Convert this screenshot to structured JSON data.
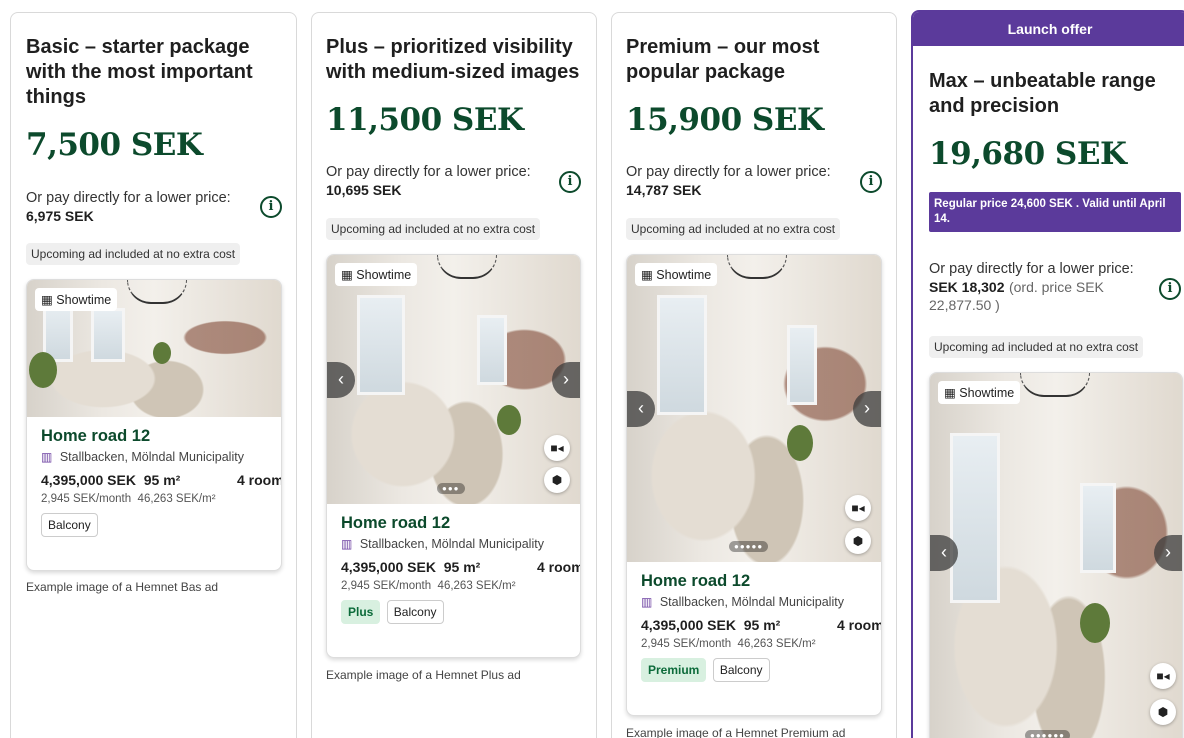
{
  "packages": [
    {
      "title": "Basic – starter package with the most important things",
      "price": "7,500 SEK",
      "direct_text": "Or pay directly for a lower price:",
      "direct_amount": "6,975 SEK",
      "direct_ord": "",
      "chip": "Upcoming ad included at no extra cost",
      "showtime": "Showtime",
      "address": "Home road 12",
      "location": "Stallbacken, Mölndal Municipality",
      "price_sek": "4,395,000 SEK",
      "area": "95 m²",
      "rooms": "4 room",
      "monthly": "2,945 SEK/month",
      "per_sqm": "46,263 SEK/m²",
      "level_tag": "",
      "feature_tag": "Balcony",
      "caption": "Example image of a Hemnet Bas ad"
    },
    {
      "title": "Plus – prioritized visibility with medium-sized images",
      "price": "11,500 SEK",
      "direct_text": "Or pay directly for a lower price:",
      "direct_amount": "10,695 SEK",
      "direct_ord": "",
      "chip": "Upcoming ad included at no extra cost",
      "showtime": "Showtime",
      "address": "Home road 12",
      "location": "Stallbacken, Mölndal Municipality",
      "price_sek": "4,395,000 SEK",
      "area": "95 m²",
      "rooms": "4 room",
      "monthly": "2,945 SEK/month",
      "per_sqm": "46,263 SEK/m²",
      "level_tag": "Plus",
      "feature_tag": "Balcony",
      "caption": "Example image of a Hemnet Plus ad"
    },
    {
      "title": "Premium – our most popular package",
      "price": "15,900 SEK",
      "direct_text": "Or pay directly for a lower price:",
      "direct_amount": "14,787 SEK",
      "direct_ord": "",
      "chip": "Upcoming ad included at no extra cost",
      "showtime": "Showtime",
      "address": "Home road 12",
      "location": "Stallbacken, Mölndal Municipality",
      "price_sek": "4,395,000 SEK",
      "area": "95 m²",
      "rooms": "4 room",
      "monthly": "2,945 SEK/month",
      "per_sqm": "46,263 SEK/m²",
      "level_tag": "Premium",
      "feature_tag": "Balcony",
      "caption": "Example image of a Hemnet Premium ad"
    },
    {
      "launch_label": "Launch offer",
      "title": "Max – unbeatable range and precision",
      "price": "19,680 SEK",
      "regular_note": "Regular price 24,600 SEK . Valid until April 14.",
      "direct_text": "Or pay directly for a lower price:",
      "direct_amount": "SEK 18,302",
      "direct_ord": "(ord. price SEK 22,877.50 )",
      "chip": "Upcoming ad included at no extra cost",
      "showtime": "Showtime"
    }
  ],
  "icons": {
    "info": "i",
    "arrow_left": "‹",
    "arrow_right": "›",
    "video": "■◂",
    "cube": "⬢",
    "calendar": "▦",
    "building": "▥",
    "dots_plus": "●●●",
    "dots_premium": "●●●●●",
    "dots_max": "●●●●●●"
  },
  "colors": {
    "price_green": "#0c4a2c",
    "launch_purple": "#5b3a9b",
    "tag_green_bg": "#d8f0e0"
  }
}
